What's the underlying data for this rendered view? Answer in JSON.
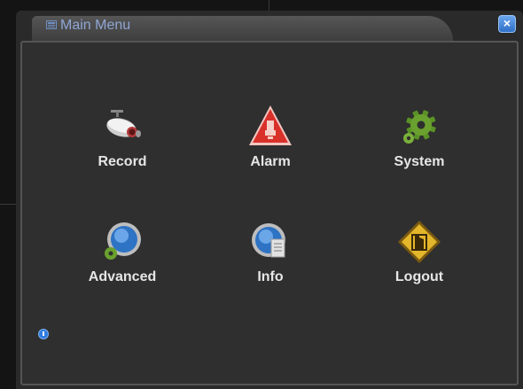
{
  "window": {
    "title": "Main Menu",
    "close_label": "×"
  },
  "menu": {
    "items": [
      {
        "label": "Record",
        "icon": "camera-icon"
      },
      {
        "label": "Alarm",
        "icon": "alarm-icon"
      },
      {
        "label": "System",
        "icon": "gear-icon"
      },
      {
        "label": "Advanced",
        "icon": "advanced-icon"
      },
      {
        "label": "Info",
        "icon": "info-icon"
      },
      {
        "label": "Logout",
        "icon": "logout-icon"
      }
    ]
  },
  "colors": {
    "title_text": "#8fa6d4",
    "accent_blue": "#2f7be0",
    "label_text": "#e6e6e6",
    "alarm_red": "#d8312a",
    "system_green": "#6aa12e",
    "logout_gold": "#e3b62b"
  }
}
